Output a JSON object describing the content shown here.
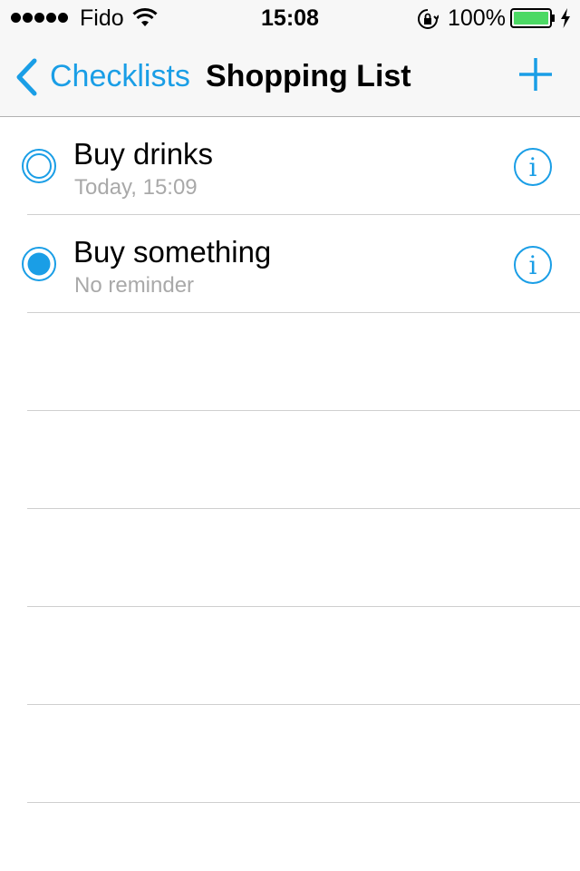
{
  "status_bar": {
    "carrier": "Fido",
    "time": "15:08",
    "battery_percent": "100%",
    "battery_color": "#4cd964"
  },
  "nav_bar": {
    "back_label": "Checklists",
    "title": "Shopping List",
    "add_icon": "plus-icon",
    "accent_color": "#1a9ee6"
  },
  "items": [
    {
      "title": "Buy drinks",
      "subtitle": "Today, 15:09",
      "checked": false
    },
    {
      "title": "Buy something",
      "subtitle": "No reminder",
      "checked": true
    }
  ]
}
